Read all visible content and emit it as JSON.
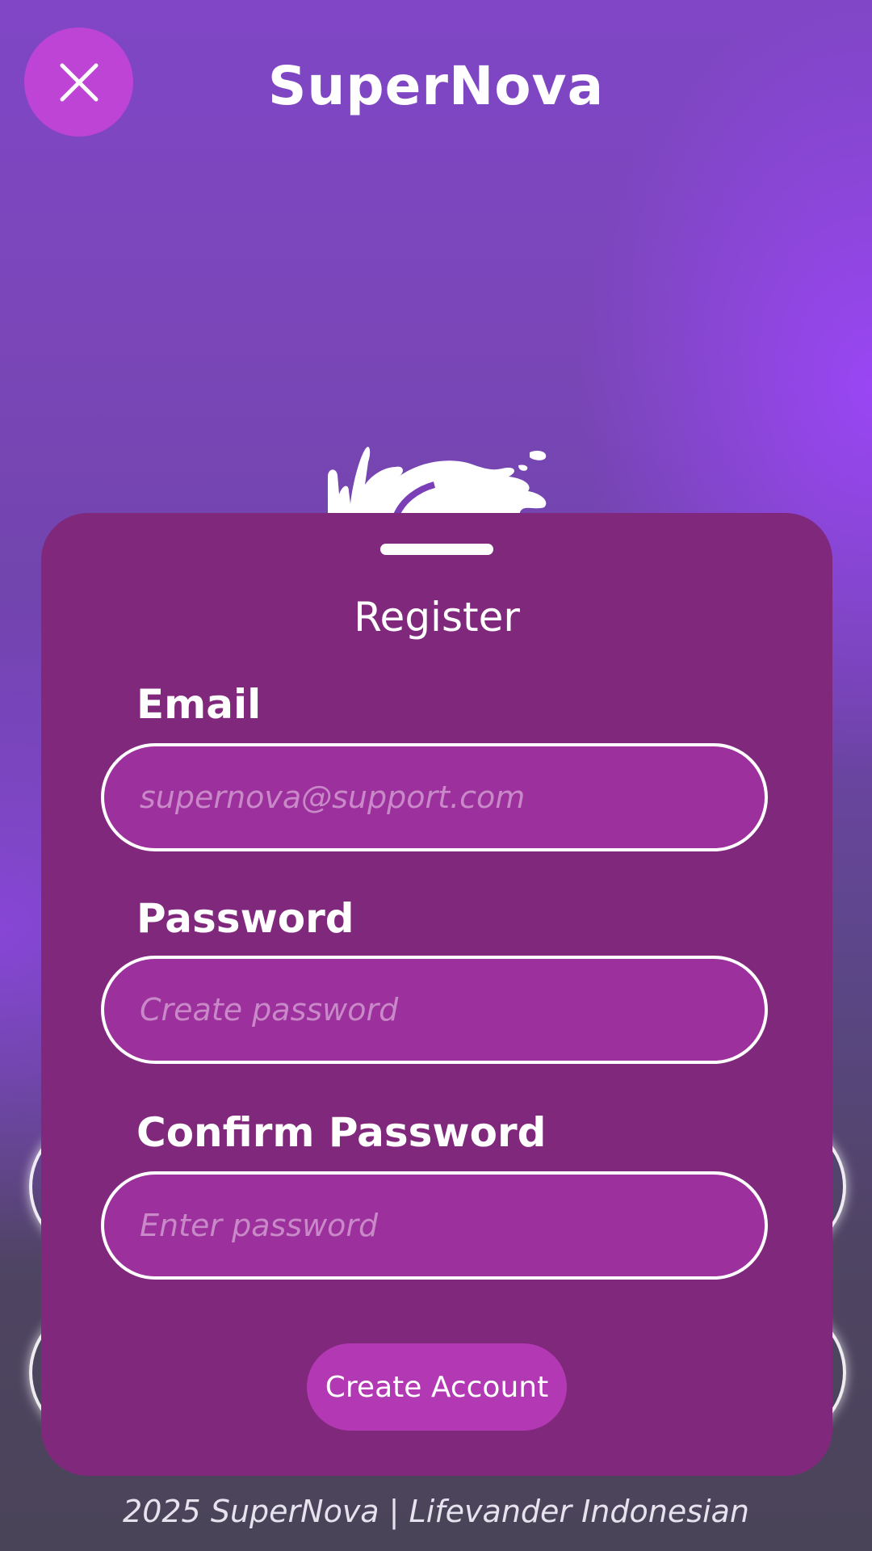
{
  "header": {
    "title": "SuperNova",
    "close_icon": "close-icon"
  },
  "register": {
    "title": "Register",
    "email": {
      "label": "Email",
      "placeholder": "supernova@support.com",
      "value": ""
    },
    "password": {
      "label": "Password",
      "placeholder": "Create password",
      "value": ""
    },
    "confirm_password": {
      "label": "Confirm Password",
      "placeholder": "Enter password",
      "value": ""
    },
    "submit_label": "Create Account"
  },
  "footer": {
    "text": "2025 SuperNova | Lifevander Indonesian"
  },
  "colors": {
    "accent": "#bd44d4",
    "sheet": "#80287c",
    "input_fill": "#9c309c",
    "button": "#b338b4"
  }
}
